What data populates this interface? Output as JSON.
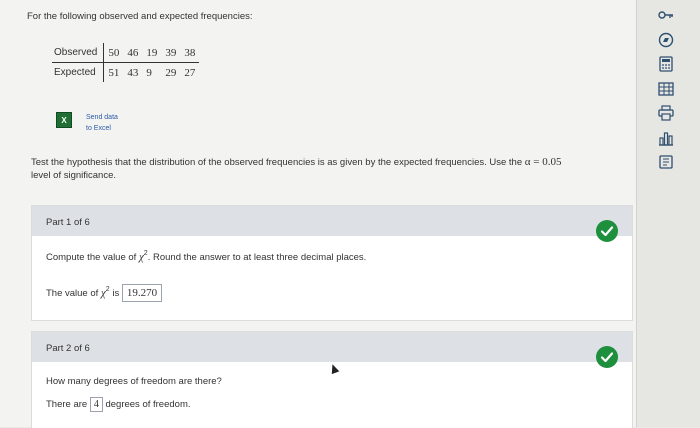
{
  "prompt": "For the following observed and expected frequencies:",
  "table": {
    "rows": [
      {
        "label": "Observed",
        "values": [
          "50",
          "46",
          "19",
          "39",
          "38"
        ]
      },
      {
        "label": "Expected",
        "values": [
          "51",
          "43",
          "9",
          "29",
          "27"
        ]
      }
    ]
  },
  "excel": {
    "line1": "Send data",
    "line2": "to Excel"
  },
  "hypothesis": {
    "text": "Test the hypothesis that the distribution of the observed frequencies is as given by the expected frequencies. Use the",
    "alpha": "α = 0.05",
    "suffix": "level of significance."
  },
  "part1": {
    "header": "Part 1 of 6",
    "question_prefix": "Compute the value of",
    "question_symbol": "χ",
    "question_sup": "2",
    "question_suffix": ". Round the answer to at least three decimal places.",
    "answer_prefix": "The value of",
    "answer_symbol": "χ",
    "answer_sup": "2",
    "answer_mid": "is",
    "answer_value": "19.270"
  },
  "part2": {
    "header": "Part 2 of 6",
    "question": "How many degrees of freedom are there?",
    "answer_prefix": "There are",
    "answer_value": "4",
    "answer_suffix": "degrees of freedom."
  },
  "toolbar": [
    "key-icon",
    "compass-icon",
    "calculator-icon",
    "table-icon",
    "print-icon",
    "chart-icon",
    "book-icon"
  ],
  "colors": {
    "check": "#1e8f3c",
    "header": "#dde1e6",
    "link": "#2b5aa8"
  }
}
